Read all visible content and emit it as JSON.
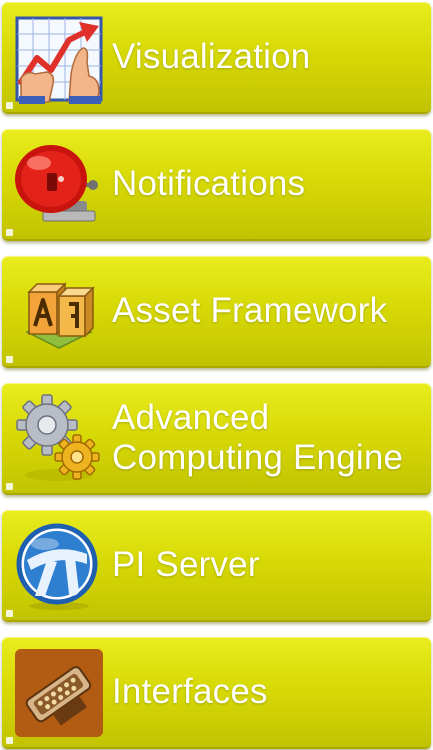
{
  "menu": {
    "items": [
      {
        "label": "Visualization",
        "icon": "chart-icon"
      },
      {
        "label": "Notifications",
        "icon": "alarm-bell-icon"
      },
      {
        "label": "Asset Framework",
        "icon": "af-blocks-icon"
      },
      {
        "label_line1": "Advanced",
        "label_line2": "Computing Engine",
        "icon": "gears-icon"
      },
      {
        "label": "PI Server",
        "icon": "pi-server-icon"
      },
      {
        "label": "Interfaces",
        "icon": "connector-icon"
      }
    ]
  },
  "colors": {
    "tile": "#d8da07",
    "label": "#ffffff"
  }
}
